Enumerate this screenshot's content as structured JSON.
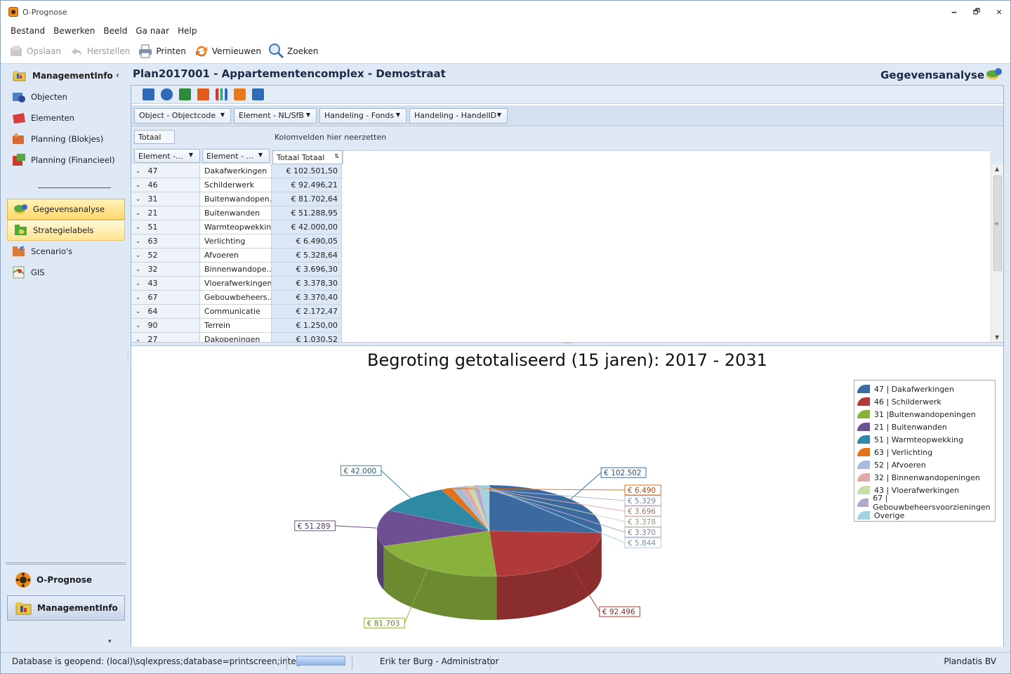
{
  "window": {
    "title": "O-Prognose",
    "minimize": "🗕",
    "restore": "🗗",
    "close": "✕"
  },
  "menu": [
    "Bestand",
    "Bewerken",
    "Beeld",
    "Ga naar",
    "Help"
  ],
  "toolbar": {
    "save": "Opslaan",
    "restore": "Herstellen",
    "print": "Printen",
    "refresh": "Vernieuwen",
    "search": "Zoeken"
  },
  "sidebar": {
    "header": "ManagementInfo",
    "collapse": "‹",
    "items": [
      "Objecten",
      "Elementen",
      "Planning (Blokjes)",
      "Planning (Financieel)"
    ],
    "items2": [
      "Gegevensanalyse",
      "Strategielabels",
      "Scenario's",
      "GIS"
    ],
    "bottom": [
      "O-Prognose",
      "ManagementInfo"
    ],
    "more": "▾"
  },
  "page": {
    "title": "Plan2017001 - Appartementencomplex - Demostraat",
    "section": "Gegevensanalyse"
  },
  "pivot": {
    "filters": [
      "Object - Objectcode",
      "Element - NL/SfB",
      "Handeling - Fonds",
      "Handeling - HandelID"
    ],
    "total_label": "Totaal",
    "drop_hint": "Kolomvelden hier neerzetten",
    "row_fields": [
      "Element -...",
      "Element - ..."
    ],
    "value_header": "Totaal Totaal",
    "rows": [
      {
        "code": "47",
        "name": "Dakafwerkingen",
        "value": "€ 102.501,50"
      },
      {
        "code": "46",
        "name": "Schilderwerk",
        "value": "€ 92.496,21"
      },
      {
        "code": "31",
        "name": "Buitenwandopen...",
        "value": "€ 81.702,64"
      },
      {
        "code": "21",
        "name": "Buitenwanden",
        "value": "€ 51.288,95"
      },
      {
        "code": "51",
        "name": "Warmteopwekking",
        "value": "€ 42.000,00"
      },
      {
        "code": "63",
        "name": "Verlichting",
        "value": "€ 6.490,05"
      },
      {
        "code": "52",
        "name": "Afvoeren",
        "value": "€ 5.328,64"
      },
      {
        "code": "32",
        "name": "Binnenwandope...",
        "value": "€ 3.696,30"
      },
      {
        "code": "43",
        "name": "Vloerafwerkingen",
        "value": "€ 3.378,30"
      },
      {
        "code": "67",
        "name": "Gebouwbeheers...",
        "value": "€ 3.370,40"
      },
      {
        "code": "64",
        "name": "Communicatie",
        "value": "€ 2.172,47"
      },
      {
        "code": "90",
        "name": "Terrein",
        "value": "€ 1.250,00"
      },
      {
        "code": "27",
        "name": "Dakopeningen",
        "value": "€ 1.030,52"
      }
    ]
  },
  "chart_data": {
    "type": "pie",
    "title": "Begroting getotaliseerd (15 jaren): 2017 - 2031",
    "legend_position": "right",
    "series": [
      {
        "name": "47 | Dakafwerkingen",
        "value": 102502,
        "label": "€ 102.502",
        "color": "#3b6aa1"
      },
      {
        "name": "46 | Schilderwerk",
        "value": 92496,
        "label": "€ 92.496",
        "color": "#b03a3a"
      },
      {
        "name": "31 |Buitenwandopeningen",
        "value": 81703,
        "label": "€ 81.703",
        "color": "#8ab13c"
      },
      {
        "name": "21 | Buitenwanden",
        "value": 51289,
        "label": "€ 51.289",
        "color": "#6e4f92"
      },
      {
        "name": "51 | Warmteopwekking",
        "value": 42000,
        "label": "€ 42.000",
        "color": "#2e8aa3"
      },
      {
        "name": "63 | Verlichting",
        "value": 6490,
        "label": "€ 6.490",
        "color": "#e3721c"
      },
      {
        "name": "52 | Afvoeren",
        "value": 5329,
        "label": "€ 5.329",
        "color": "#a6bcd8"
      },
      {
        "name": "32 | Binnenwandopeningen",
        "value": 3696,
        "label": "€ 3.696",
        "color": "#e0aaa8"
      },
      {
        "name": "43 | Vloerafwerkingen",
        "value": 3378,
        "label": "€ 3.378",
        "color": "#c8dcaa"
      },
      {
        "name": "67 | Gebouwbeheersvoorzieningen",
        "value": 3370,
        "label": "€ 3.370",
        "color": "#b7a8cb"
      },
      {
        "name": "Overige",
        "value": 5844,
        "label": "€ 5.844",
        "color": "#a3d3e0"
      }
    ]
  },
  "status": {
    "db": "Database is geopend: (local)\\sqlexpress;database=printscreen;integrated",
    "user": "Erik ter Burg - Administrator",
    "company": "Plandatis BV"
  }
}
